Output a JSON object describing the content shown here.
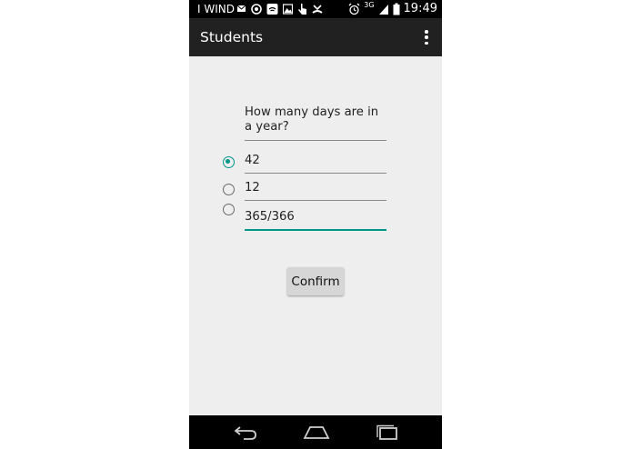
{
  "status_bar": {
    "carrier": "I WIND",
    "network": "3G",
    "time": "19:49"
  },
  "action_bar": {
    "title": "Students",
    "overflow_icon": "overflow-menu-icon"
  },
  "quiz": {
    "question": "How many days are in a year?",
    "answers": [
      {
        "text": "42",
        "selected": true
      },
      {
        "text": "12",
        "selected": false
      },
      {
        "text": "365/366",
        "selected": false
      }
    ],
    "confirm_label": "Confirm"
  },
  "nav_bar": {
    "icons": [
      "back-icon",
      "home-icon",
      "recent-apps-icon"
    ]
  },
  "colors": {
    "accent": "#009688",
    "action_bar": "#212121",
    "background": "#eeeeee"
  }
}
